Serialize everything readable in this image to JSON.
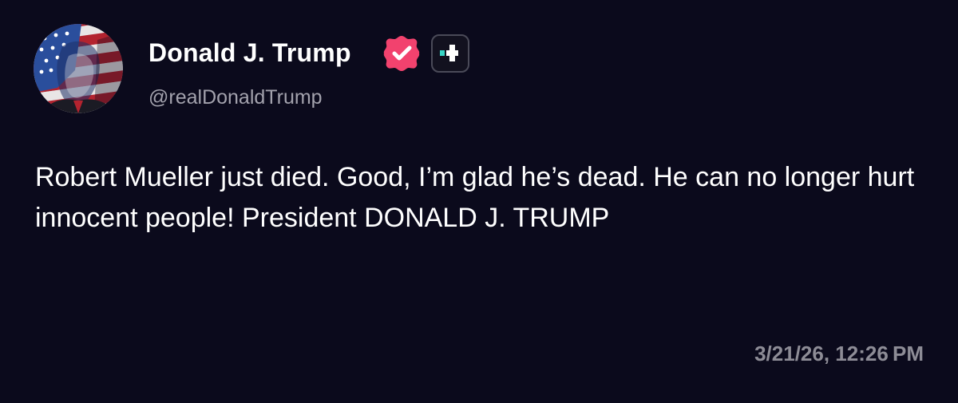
{
  "post": {
    "author": {
      "display_name": "Donald J. Trump",
      "handle": "@realDonaldTrump",
      "avatar_icon": "flag-portrait-avatar",
      "verified_icon": "verified-badge-icon",
      "plus_icon": "plus-badge-icon"
    },
    "body": "Robert Mueller just died. Good, I’m glad he’s dead. He can no longer hurt innocent people! President DONALD J. TRUMP",
    "timestamp": "3/21/26, 12:26 PM"
  },
  "colors": {
    "background": "#0b0a1c",
    "text": "#ffffff",
    "handle": "#a3a2ad",
    "timestamp": "#8d8c96",
    "verified": "#f2426e",
    "plus_accent": "#37d5c6"
  }
}
